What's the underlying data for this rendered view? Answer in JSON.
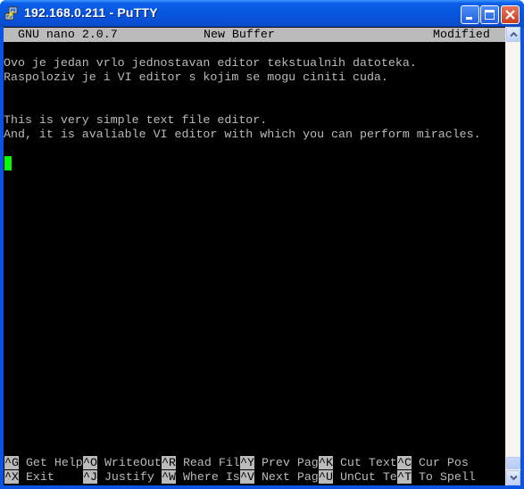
{
  "window": {
    "title": "192.168.0.211 - PuTTY",
    "icon": "putty-computer-icon",
    "controls": [
      "minimize",
      "maximize",
      "close"
    ]
  },
  "nano": {
    "status_bar": {
      "version": "GNU nano 2.0.7",
      "buffer": "New Buffer",
      "state": "Modified"
    },
    "lines": [
      "Ovo je jedan vrlo jednostavan editor tekstualnih datoteka.",
      "Raspoloziv je i VI editor s kojim se mogu ciniti cuda.",
      "",
      "",
      "This is very simple text file editor.",
      "And, it is avaliable VI editor with which you can perform miracles.",
      "",
      ""
    ],
    "cursor_color": "#00ff00",
    "shortcuts_row1": [
      {
        "key": "^G",
        "label": " Get Help"
      },
      {
        "key": "^O",
        "label": " WriteOut"
      },
      {
        "key": "^R",
        "label": " Read Fil"
      },
      {
        "key": "^Y",
        "label": " Prev Pag"
      },
      {
        "key": "^K",
        "label": " Cut Text"
      },
      {
        "key": "^C",
        "label": " Cur Pos"
      }
    ],
    "shortcuts_row2": [
      {
        "key": "^X",
        "label": " Exit"
      },
      {
        "key": "^J",
        "label": " Justify"
      },
      {
        "key": "^W",
        "label": " Where Is"
      },
      {
        "key": "^V",
        "label": " Next Pag"
      },
      {
        "key": "^U",
        "label": " UnCut Te"
      },
      {
        "key": "^T",
        "label": " To Spell"
      }
    ]
  },
  "scrollbar": {
    "position_fraction": 1.0
  }
}
